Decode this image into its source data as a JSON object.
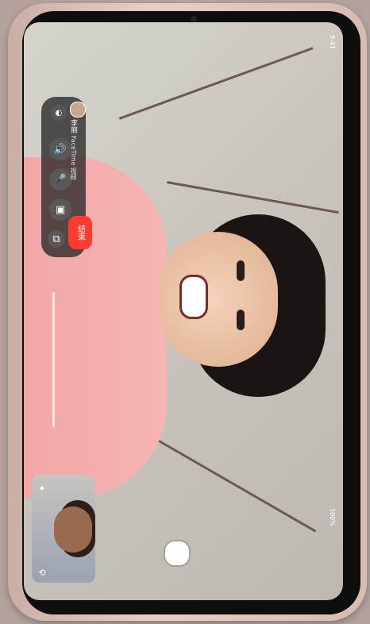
{
  "caller": {
    "name": "李丽",
    "status": "FaceTime 视频"
  },
  "controls": {
    "end_label": "结束"
  },
  "status_bar": {
    "time": "9:41",
    "battery": "100%"
  },
  "colors": {
    "end": "#ff3b30",
    "panel": "#282828",
    "shirt": "#f4aead"
  }
}
